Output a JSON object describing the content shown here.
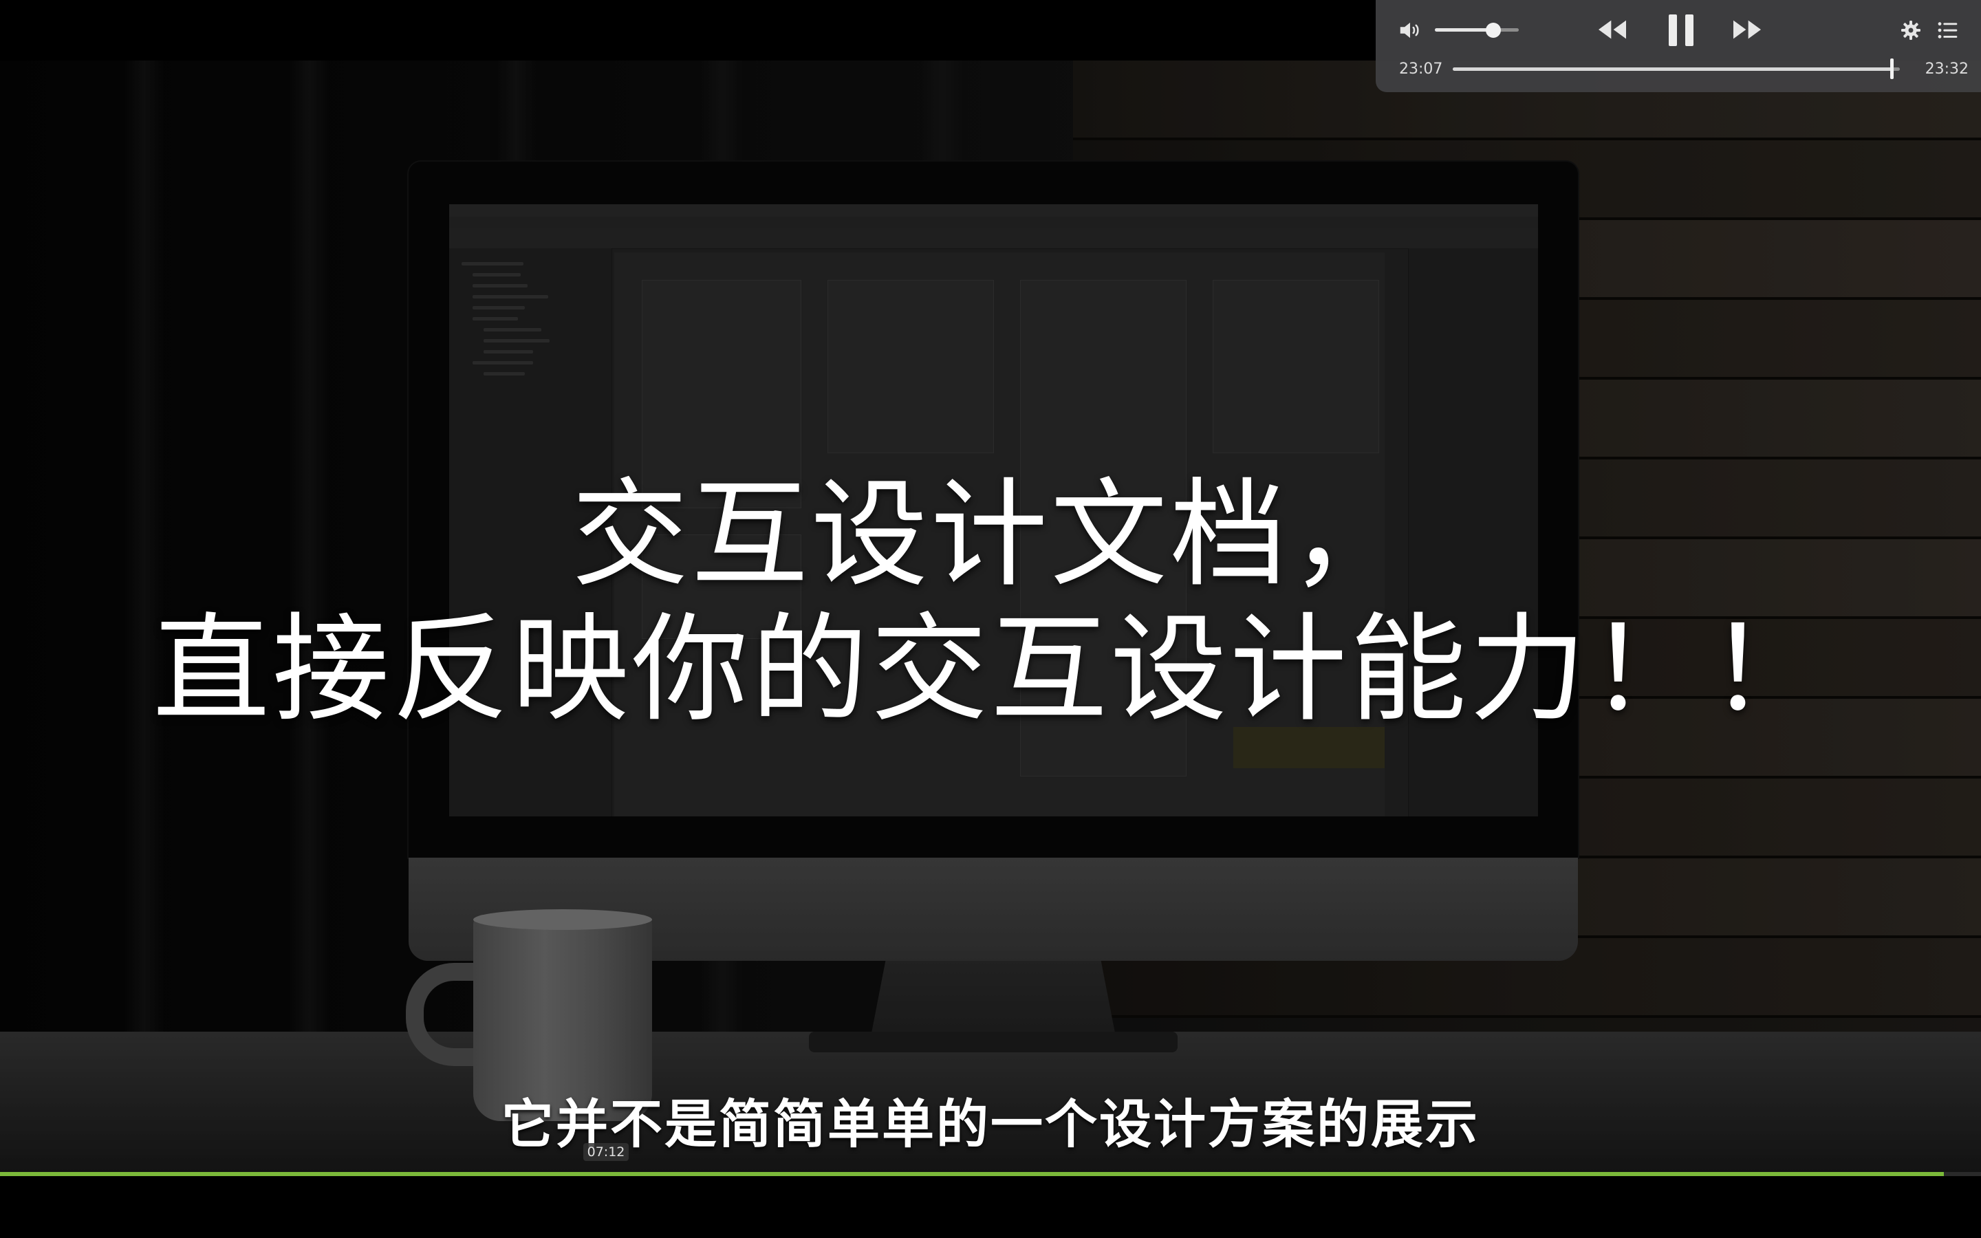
{
  "player": {
    "volume_level": 0.7,
    "time_current": "23:07",
    "time_total": "23:32",
    "progress_fraction": 0.9823,
    "state": "playing",
    "icons": {
      "volume": "volume-icon",
      "rewind": "rewind-icon",
      "pause": "pause-icon",
      "forward": "fast-forward-icon",
      "settings": "gear-icon",
      "playlist": "list-icon"
    }
  },
  "video": {
    "caption_main_line1": "交互设计文档，",
    "caption_main_line2": "直接反映你的交互设计能力！！",
    "caption_sub": "它并不是简简单单的一个设计方案的展示",
    "scrub_preview_time": "07:12",
    "bottom_progress_fraction": 0.9813
  },
  "colors": {
    "progress_green": "#7bb93a",
    "control_bg": "#404042",
    "caption_text": "#ffffff"
  }
}
